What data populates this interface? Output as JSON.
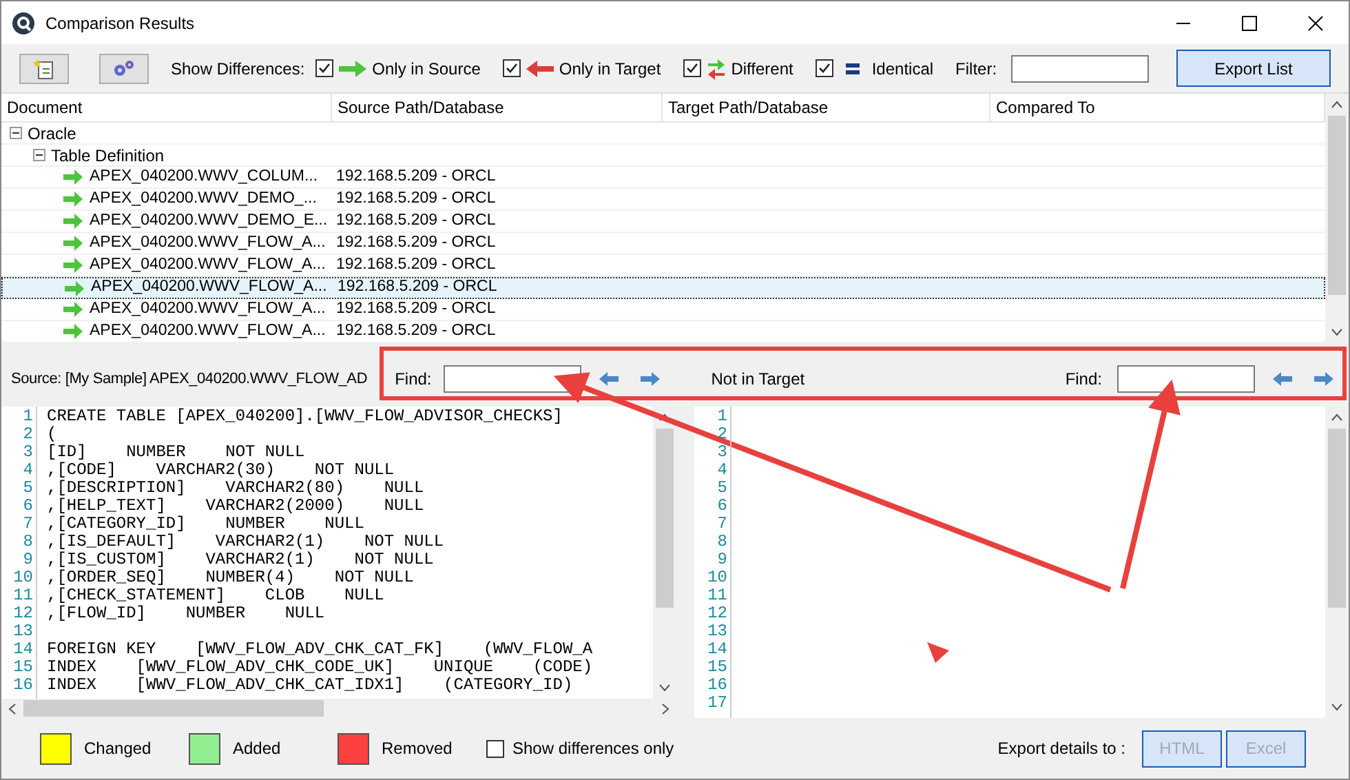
{
  "window": {
    "title": "Comparison Results"
  },
  "toolbar": {
    "show_label": "Show Differences:",
    "filters": [
      {
        "kind": "source",
        "label": "Only in Source",
        "checked": true
      },
      {
        "kind": "target",
        "label": "Only in Target",
        "checked": true
      },
      {
        "kind": "different",
        "label": "Different",
        "checked": true
      },
      {
        "kind": "identical",
        "label": "Identical",
        "checked": true
      }
    ],
    "filter_label": "Filter:",
    "export_button": "Export List"
  },
  "grid": {
    "columns": [
      "Document",
      "Source Path/Database",
      "Target Path/Database",
      "Compared To"
    ],
    "tree": [
      {
        "label": "Oracle",
        "expanded": true,
        "children": [
          {
            "label": "Table Definition",
            "expanded": true,
            "children": [
              {
                "label": "APEX_040200.WWV_COLUM...",
                "source": "192.168.5.209 - ORCL",
                "selected": false
              },
              {
                "label": "APEX_040200.WWV_DEMO_...",
                "source": "192.168.5.209 - ORCL",
                "selected": false
              },
              {
                "label": "APEX_040200.WWV_DEMO_E...",
                "source": "192.168.5.209 - ORCL",
                "selected": false
              },
              {
                "label": "APEX_040200.WWV_FLOW_A...",
                "source": "192.168.5.209 - ORCL",
                "selected": false
              },
              {
                "label": "APEX_040200.WWV_FLOW_A...",
                "source": "192.168.5.209 - ORCL",
                "selected": false
              },
              {
                "label": "APEX_040200.WWV_FLOW_A...",
                "source": "192.168.5.209 - ORCL",
                "selected": true
              },
              {
                "label": "APEX_040200.WWV_FLOW_A...",
                "source": "192.168.5.209 - ORCL",
                "selected": false
              },
              {
                "label": "APEX_040200.WWV_FLOW_A...",
                "source": "192.168.5.209 - ORCL",
                "selected": false
              }
            ]
          }
        ]
      }
    ]
  },
  "find_bar": {
    "source_label": "Source: [My Sample] APEX_040200.WWV_FLOW_AD",
    "find_label_left": "Find:",
    "target_label": "Not in Target",
    "find_label_right": "Find:"
  },
  "source_code": [
    {
      "number": "1",
      "text": "CREATE TABLE [APEX_040200].[WWV_FLOW_ADVISOR_CHECKS]"
    },
    {
      "number": "2",
      "text": "("
    },
    {
      "number": "3",
      "text": "[ID]    NUMBER    NOT NULL"
    },
    {
      "number": "4",
      "text": ",[CODE]    VARCHAR2(30)    NOT NULL"
    },
    {
      "number": "5",
      "text": ",[DESCRIPTION]    VARCHAR2(80)    NULL"
    },
    {
      "number": "6",
      "text": ",[HELP_TEXT]    VARCHAR2(2000)    NULL"
    },
    {
      "number": "7",
      "text": ",[CATEGORY_ID]    NUMBER    NULL"
    },
    {
      "number": "8",
      "text": ",[IS_DEFAULT]    VARCHAR2(1)    NOT NULL"
    },
    {
      "number": "9",
      "text": ",[IS_CUSTOM]    VARCHAR2(1)    NOT NULL"
    },
    {
      "number": "10",
      "text": ",[ORDER_SEQ]    NUMBER(4)    NOT NULL"
    },
    {
      "number": "11",
      "text": ",[CHECK_STATEMENT]    CLOB    NULL"
    },
    {
      "number": "12",
      "text": ",[FLOW_ID]    NUMBER    NULL"
    },
    {
      "number": "13"
    },
    {
      "number": "14",
      "text": "FOREIGN KEY    [WWV_FLOW_ADV_CHK_CAT_FK]    (WWV_FLOW_A"
    },
    {
      "number": "15",
      "text": "INDEX    [WWV_FLOW_ADV_CHK_CODE_UK]    UNIQUE    (CODE)"
    },
    {
      "number": "16",
      "text": "INDEX    [WWV_FLOW_ADV_CHK_CAT_IDX1]    (CATEGORY_ID)"
    }
  ],
  "target_code": [
    "1",
    "2",
    "3",
    "4",
    "5",
    "6",
    "7",
    "8",
    "9",
    "10",
    "11",
    "12",
    "13",
    "14",
    "15",
    "16",
    "17"
  ],
  "legend": [
    {
      "label": "Changed",
      "color": "#ffff00"
    },
    {
      "label": "Added",
      "color": "#90ee90"
    },
    {
      "label": "Removed",
      "color": "#ff4040"
    }
  ],
  "show_differences_only": {
    "label": "Show differences only",
    "checked": false
  },
  "export": {
    "label": "Export details to :",
    "buttons": [
      {
        "label": "HTML",
        "disabled": true
      },
      {
        "label": "Excel",
        "disabled": true
      }
    ]
  }
}
